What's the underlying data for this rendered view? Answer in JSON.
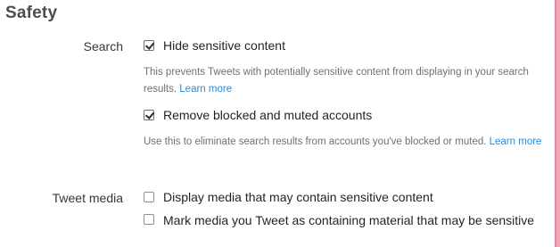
{
  "section": {
    "title": "Safety"
  },
  "search": {
    "label": "Search",
    "hide_sensitive": {
      "label": "Hide sensitive content",
      "checked": true,
      "help_text": "This prevents Tweets with potentially sensitive content from displaying in your search results.",
      "learn_more": "Learn more"
    },
    "remove_blocked": {
      "label": "Remove blocked and muted accounts",
      "checked": true,
      "help_text": "Use this to eliminate search results from accounts you've blocked or muted.",
      "learn_more": "Learn more"
    }
  },
  "tweet_media": {
    "label": "Tweet media",
    "display_sensitive": {
      "label": "Display media that may contain sensitive content",
      "checked": false
    },
    "mark_sensitive": {
      "label": "Mark media you Tweet as containing material that may be sensitive",
      "checked": false
    }
  },
  "colors": {
    "link": "#2a8ad8",
    "accent_border": "#e8879f"
  }
}
